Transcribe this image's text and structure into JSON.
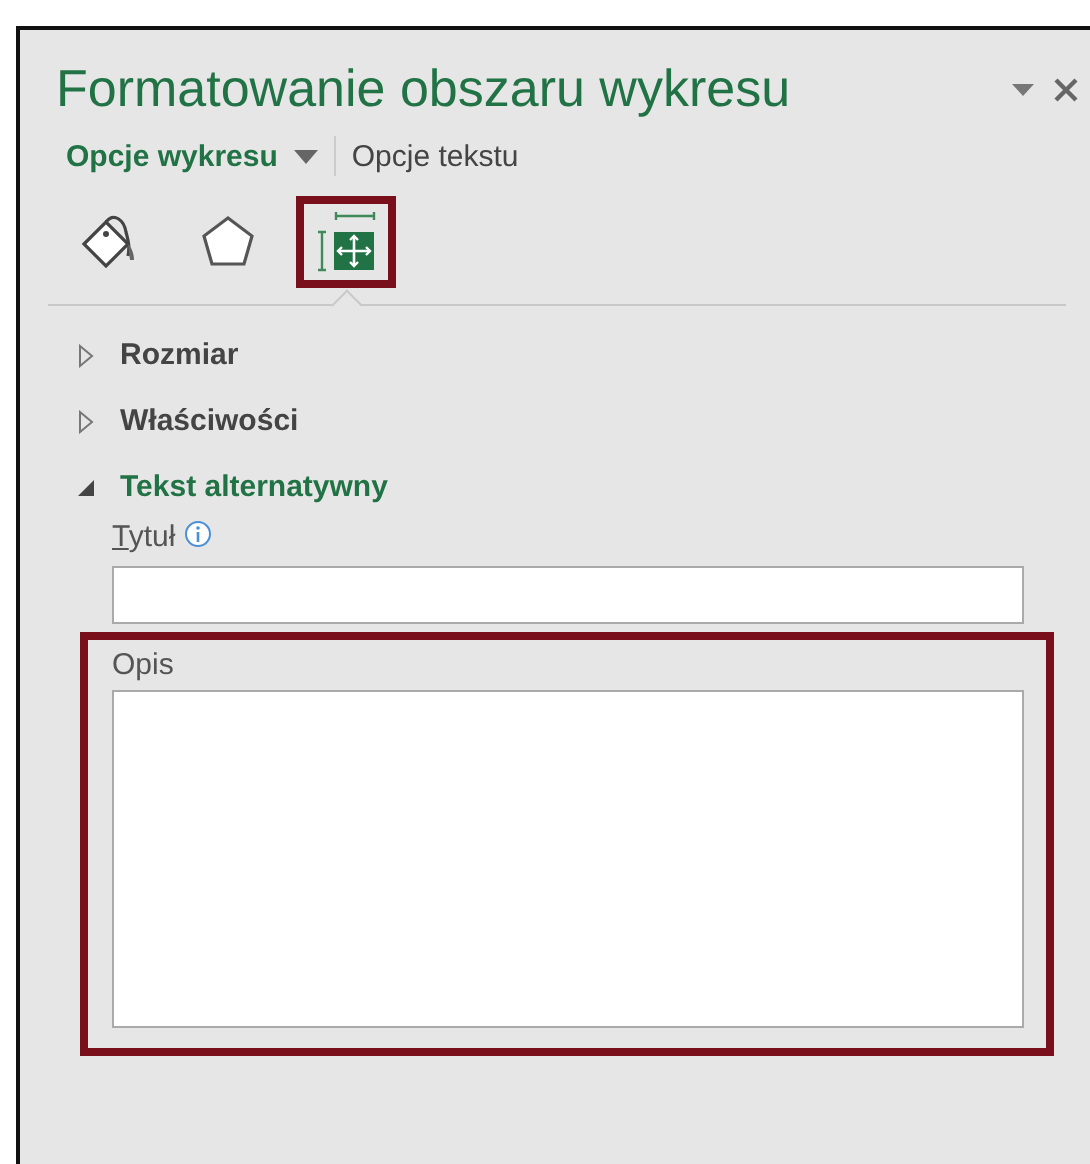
{
  "pane": {
    "title": "Formatowanie obszaru wykresu"
  },
  "option_tabs": [
    {
      "label": "Opcje wykresu",
      "selected": true,
      "has_dropdown": true
    },
    {
      "label": "Opcje tekstu",
      "selected": false,
      "has_dropdown": false
    }
  ],
  "icon_tabs": [
    {
      "kind": "fill",
      "selected": false,
      "highlighted": false
    },
    {
      "kind": "shape",
      "selected": false,
      "highlighted": false
    },
    {
      "kind": "size",
      "selected": true,
      "highlighted": true
    }
  ],
  "sections": [
    {
      "label": "Rozmiar",
      "expanded": false
    },
    {
      "label": "Właściwości",
      "expanded": false
    },
    {
      "label": "Tekst alternatywny",
      "expanded": true
    }
  ],
  "alt_text": {
    "title_label": "Tytuł",
    "description_label": "Opis",
    "description_highlighted": true
  }
}
